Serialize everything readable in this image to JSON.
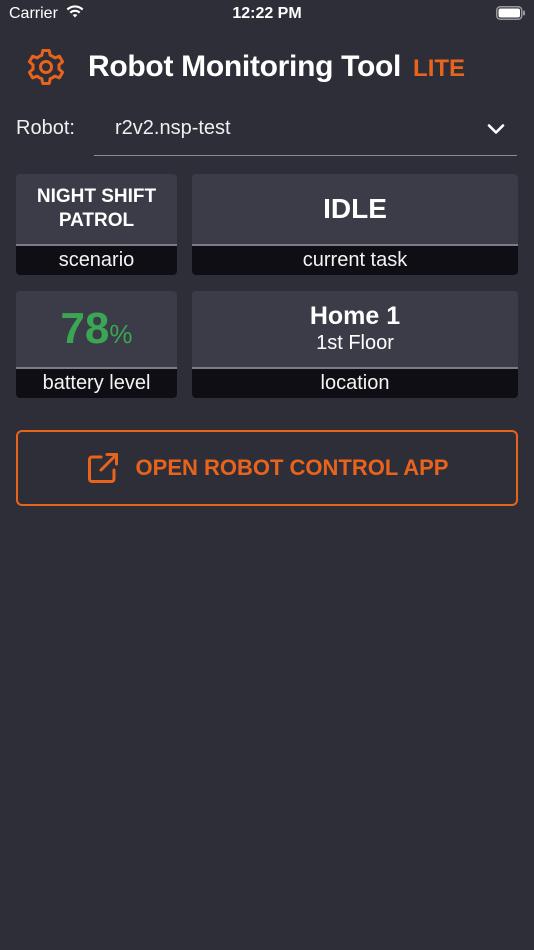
{
  "status_bar": {
    "carrier": "Carrier",
    "time": "12:22 PM"
  },
  "header": {
    "title": "Robot Monitoring Tool",
    "badge": "LITE",
    "icon": "gear-icon"
  },
  "robot_selector": {
    "label": "Robot:",
    "value": "r2v2.nsp-test",
    "icon": "chevron-down-icon"
  },
  "cards": {
    "scenario": {
      "value": "NIGHT SHIFT PATROL",
      "label": "scenario"
    },
    "task": {
      "value": "IDLE",
      "label": "current task"
    },
    "battery": {
      "value": "78",
      "unit": "%",
      "label": "battery level"
    },
    "location": {
      "name": "Home 1",
      "floor": "1st Floor",
      "label": "location"
    }
  },
  "open_button": {
    "label": "OPEN ROBOT CONTROL APP",
    "icon": "external-link-icon"
  },
  "colors": {
    "background": "#2e2e38",
    "accent": "#e8641c",
    "battery_ok": "#3aa654",
    "card": "#3c3c48",
    "card_footer": "#0e0e14"
  }
}
